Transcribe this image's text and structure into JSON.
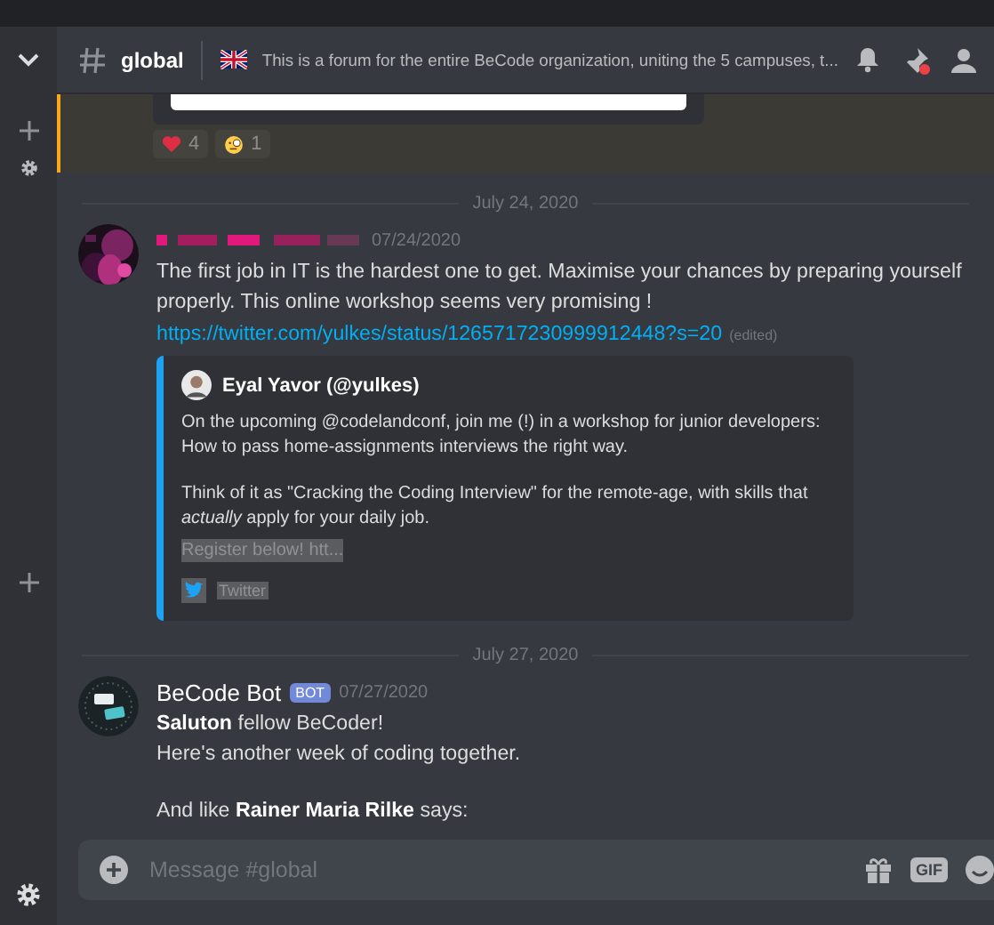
{
  "header": {
    "channel": "global",
    "topic": "This is a forum for the entire BeCode organization, uniting the 5 campuses, t..."
  },
  "previous_message": {
    "reactions": [
      {
        "kind": "heart",
        "count": "4"
      },
      {
        "kind": "monocle",
        "count": "1"
      }
    ]
  },
  "feed": [
    {
      "kind": "divider",
      "text": "July 24, 2020"
    },
    {
      "kind": "message",
      "time": "07/24/2020",
      "lines": [
        "The first job in IT is the hardest one to get. Maximise your chances by preparing yourself properly. This online workshop seems very promising !"
      ],
      "link": "https://twitter.com/yulkes/status/1265717230999912448?s=20",
      "edited": "(edited)",
      "embed": {
        "author": "Eyal Yavor (@yulkes)",
        "paragraphs": [
          "On the upcoming @codelandconf, join me (!) in a workshop for junior developers: How to pass home-assignments interviews the right way.",
          "Think of it as \"Cracking the Coding Interview\" for the remote-age, with skills that *actually* apply for your daily job."
        ],
        "link_text": "Register below! htt...",
        "footer": "Twitter"
      }
    },
    {
      "kind": "divider",
      "text": "July 27, 2020"
    },
    {
      "kind": "message",
      "author": "BeCode Bot",
      "badge": "BOT",
      "time": "07/27/2020",
      "paragraphs": [
        [
          "**Saluton** fellow BeCoder!",
          "Here's another week of coding together."
        ],
        [
          "And like **Rainer Maria Rilke** says:"
        ]
      ]
    }
  ],
  "composer": {
    "placeholder": "Message #global",
    "gif_label": "GIF"
  }
}
